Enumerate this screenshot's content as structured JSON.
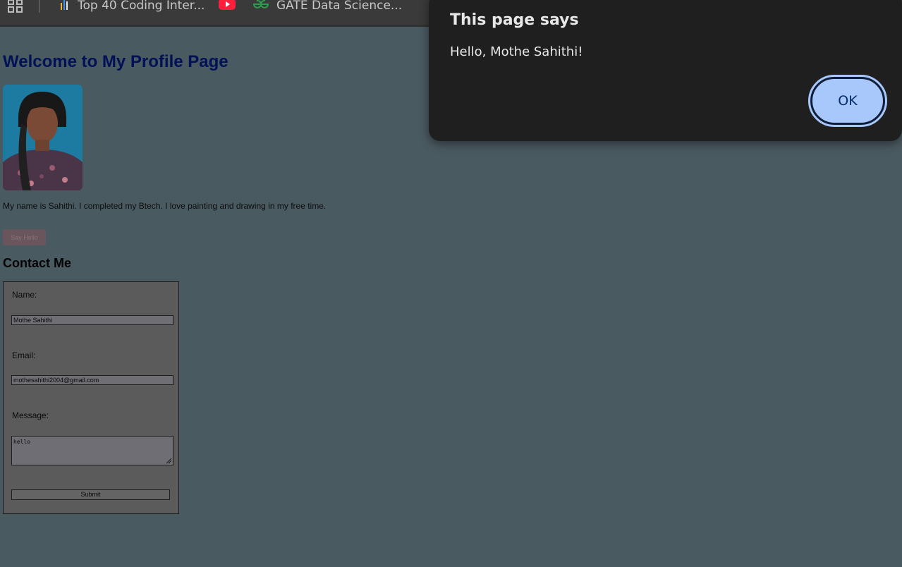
{
  "bookmarks": [
    {
      "label": "Top 40 Coding Inter...",
      "icon": "bar-chart-icon"
    },
    {
      "label": "",
      "icon": "youtube-icon"
    },
    {
      "label": "GATE Data Science...",
      "icon": "geeksforgeeks-icon"
    }
  ],
  "page": {
    "title": "Welcome to My Profile Page",
    "bio": "My name is Sahithi. I completed my Btech. I love painting and drawing in my free time.",
    "say_hello_label": "Say Hello",
    "contact_heading": "Contact Me"
  },
  "form": {
    "name_label": "Name:",
    "name_value": "Mothe Sahithi",
    "email_label": "Email:",
    "email_value": "mothesahithi2004@gmail.com",
    "message_label": "Message:",
    "message_value": "hello",
    "submit_label": "Submit"
  },
  "dialog": {
    "title": "This page says",
    "message": "Hello, Mothe Sahithi!",
    "ok_label": "OK"
  },
  "colors": {
    "page_background": "#4a5a61",
    "title": "#001155",
    "dialog_background": "#1f1f1f",
    "ok_button": "#a8c7fa"
  }
}
